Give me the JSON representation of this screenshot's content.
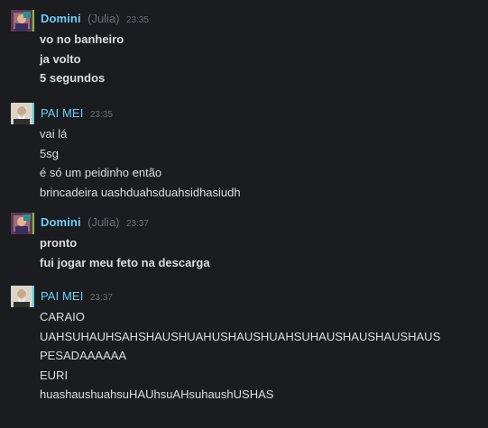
{
  "messages": [
    {
      "sender": "Domini",
      "alias": "(Julia)",
      "time": "23:35",
      "lines": [
        "vo no banheiro",
        "ja volto",
        "5 segundos"
      ]
    },
    {
      "sender": "PAI MEI",
      "alias": "",
      "time": "23:35",
      "lines": [
        "vai lá",
        "5sg",
        "é só um peidinho então",
        "brincadeira uashduahsduahsidhasiudh"
      ]
    },
    {
      "sender": "Domini",
      "alias": "(Julia)",
      "time": "23:37",
      "lines": [
        "pronto",
        "fui jogar meu feto na descarga"
      ]
    },
    {
      "sender": "PAI MEI",
      "alias": "",
      "time": "23:37",
      "lines": [
        "CARAIO",
        "UAHSUHAUHSAHSHAUSHUAHUSHAUSHUAHSUHAUSHAUSHAUSHAUS",
        "PESADAAAAAA",
        "EURI",
        "huashaushuahsuHAUhsuAHsuhaushUSHAS"
      ]
    }
  ],
  "colors": {
    "background": "#1a1c20",
    "name": "#6dcff6",
    "muted": "#6a6d72",
    "text": "#dcdedf",
    "avatar_border_domini": "#8fb93b",
    "avatar_border_paimei": "#57cbde"
  }
}
